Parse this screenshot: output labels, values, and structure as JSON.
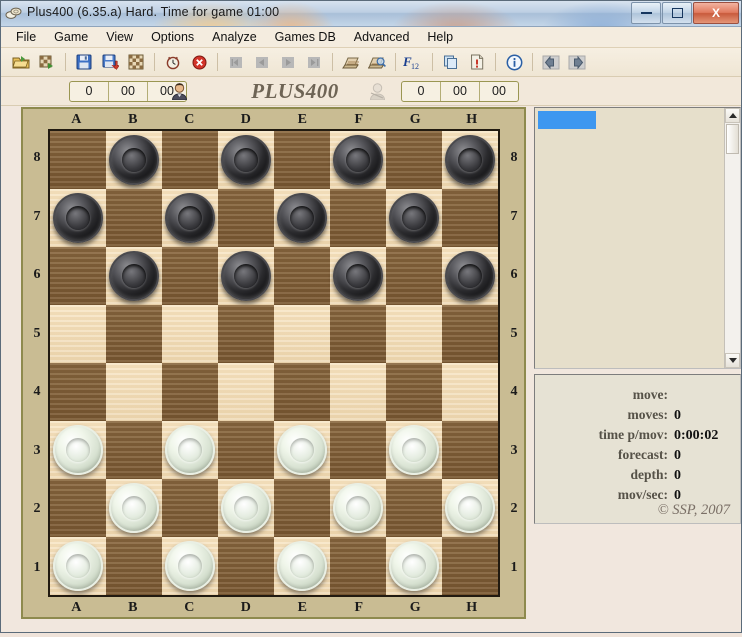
{
  "window": {
    "title": "Plus400 (6.35.a)  Hard.  Time for game 01:00",
    "app_icon": "checkers-pieces-icon",
    "minimize_label": "Minimize",
    "maximize_label": "Maximize",
    "close_label": "X"
  },
  "menu": {
    "items": [
      {
        "label": "File",
        "name": "menu-file"
      },
      {
        "label": "Game",
        "name": "menu-game"
      },
      {
        "label": "View",
        "name": "menu-view"
      },
      {
        "label": "Options",
        "name": "menu-options"
      },
      {
        "label": "Analyze",
        "name": "menu-analyze"
      },
      {
        "label": "Games DB",
        "name": "menu-games-db"
      },
      {
        "label": "Advanced",
        "name": "menu-advanced"
      },
      {
        "label": "Help",
        "name": "menu-help"
      }
    ]
  },
  "toolbar": {
    "buttons": [
      {
        "icon": "open-folder-icon",
        "enabled": true
      },
      {
        "icon": "open-board-icon",
        "enabled": true
      },
      {
        "sep": true
      },
      {
        "icon": "save-disk-icon",
        "enabled": true
      },
      {
        "icon": "save-as-icon",
        "enabled": true
      },
      {
        "icon": "board-pattern-icon",
        "enabled": true
      },
      {
        "sep": true
      },
      {
        "icon": "clock-icon",
        "enabled": true
      },
      {
        "icon": "stop-icon",
        "enabled": true
      },
      {
        "sep": true
      },
      {
        "icon": "first-move-icon",
        "enabled": false
      },
      {
        "icon": "prev-move-icon",
        "enabled": false
      },
      {
        "icon": "next-move-icon",
        "enabled": false
      },
      {
        "icon": "last-move-icon",
        "enabled": false
      },
      {
        "sep": true
      },
      {
        "icon": "print-icon",
        "enabled": true
      },
      {
        "icon": "print-preview-icon",
        "enabled": true
      },
      {
        "sep": true
      },
      {
        "icon": "f12-icon",
        "enabled": true
      },
      {
        "sep": true
      },
      {
        "icon": "copy-board-icon",
        "enabled": true
      },
      {
        "icon": "notes-icon",
        "enabled": true
      },
      {
        "sep": true
      },
      {
        "icon": "info-icon",
        "enabled": true
      },
      {
        "sep": true
      },
      {
        "icon": "arrow-left-icon",
        "enabled": true
      },
      {
        "icon": "arrow-right-icon",
        "enabled": true
      }
    ]
  },
  "scorebar": {
    "left_player_icon": "player-head-icon",
    "right_player_icon": "opponent-head-icon",
    "left_scores": [
      "0",
      "00",
      "00"
    ],
    "right_scores": [
      "0",
      "00",
      "00"
    ],
    "center_title": "PLUS400"
  },
  "board": {
    "files": [
      "A",
      "B",
      "C",
      "D",
      "E",
      "F",
      "G",
      "H"
    ],
    "ranks": [
      "8",
      "7",
      "6",
      "5",
      "4",
      "3",
      "2",
      "1"
    ],
    "light_square_color": "#f2dcb6",
    "dark_square_color": "#83643d",
    "frame_color": "#c9bc93",
    "frame_border_color": "#8e8a4e",
    "black_piece_color": "#2a2a2d",
    "white_piece_color": "#e9efe4",
    "rows": [
      [
        null,
        "black",
        null,
        "black",
        null,
        "black",
        null,
        "black"
      ],
      [
        "black",
        null,
        "black",
        null,
        "black",
        null,
        "black",
        null
      ],
      [
        null,
        "black",
        null,
        "black",
        null,
        "black",
        null,
        "black"
      ],
      [
        null,
        null,
        null,
        null,
        null,
        null,
        null,
        null
      ],
      [
        null,
        null,
        null,
        null,
        null,
        null,
        null,
        null
      ],
      [
        "white",
        null,
        "white",
        null,
        "white",
        null,
        "white",
        null
      ],
      [
        null,
        "white",
        null,
        "white",
        null,
        "white",
        null,
        "white"
      ],
      [
        "white",
        null,
        "white",
        null,
        "white",
        null,
        "white",
        null
      ]
    ],
    "dark_square_parity": 0
  },
  "movelist": {
    "selected_row_text": "",
    "entries": []
  },
  "info": {
    "rows": [
      {
        "label": "move:",
        "value": ""
      },
      {
        "label": "moves:",
        "value": "0"
      },
      {
        "label": "time p/mov:",
        "value": "0:00:02"
      },
      {
        "label": "forecast:",
        "value": "0"
      },
      {
        "label": "depth:",
        "value": "0"
      },
      {
        "label": "mov/sec:",
        "value": "0"
      }
    ]
  },
  "footer": {
    "copyright": "© SSP, 2007"
  }
}
